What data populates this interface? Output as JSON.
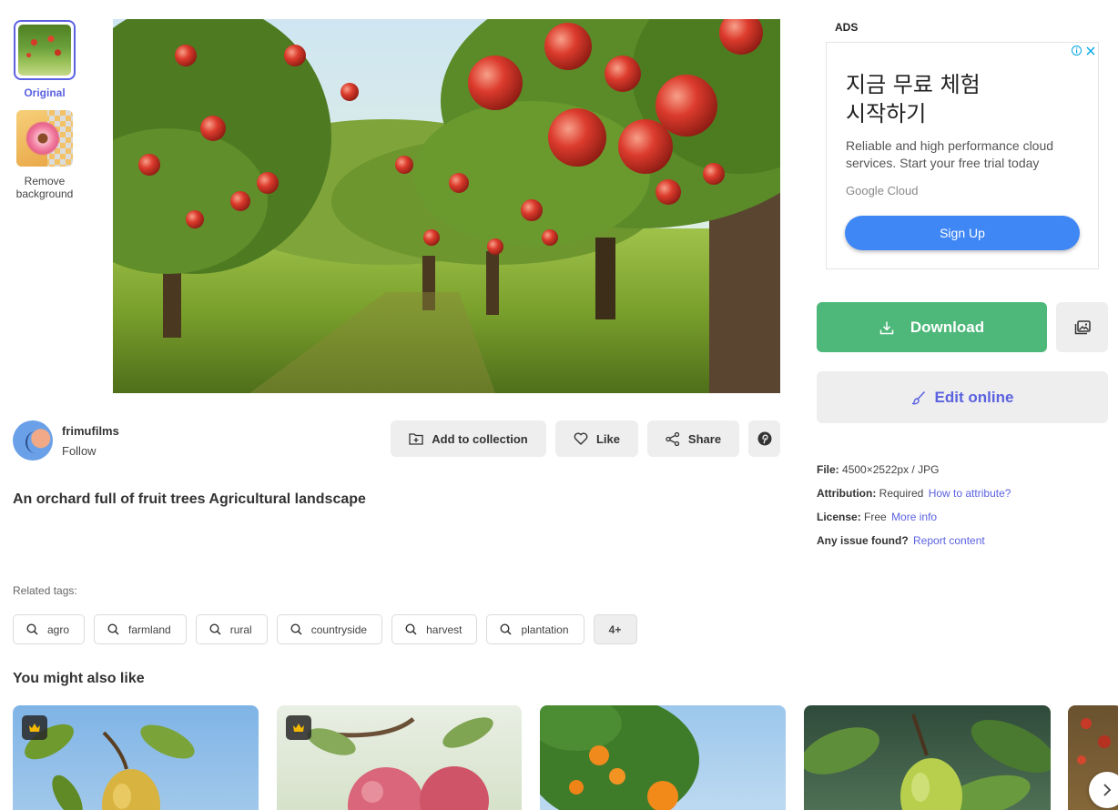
{
  "thumbnails": {
    "original_label": "Original",
    "remove_bg_label_line1": "Remove",
    "remove_bg_label_line2": "background"
  },
  "main_image": {
    "alt": "An orchard full of fruit trees Agricultural landscape"
  },
  "author": {
    "name": "frimufilms",
    "follow_label": "Follow"
  },
  "actions": {
    "add_to_collection": "Add to collection",
    "like": "Like",
    "share": "Share",
    "pinterest_icon": "pinterest-icon"
  },
  "title": "An orchard full of fruit trees Agricultural landscape",
  "related": {
    "label": "Related tags:",
    "tags": [
      "agro",
      "farmland",
      "rural",
      "countryside",
      "harvest",
      "plantation"
    ],
    "more": "4+"
  },
  "also_like": {
    "title": "You might also like",
    "cards": [
      {
        "name": "pear-on-branch",
        "premium": true
      },
      {
        "name": "pink-apples",
        "premium": true
      },
      {
        "name": "orange-tree",
        "premium": false
      },
      {
        "name": "green-pear-leaves",
        "premium": false
      },
      {
        "name": "orchard-partial",
        "premium": false
      }
    ]
  },
  "ads": {
    "label": "ADS",
    "headline_line1": "지금 무료 체험",
    "headline_line2": "시작하기",
    "body": "Reliable and high performance cloud services. Start your free trial today",
    "brand": "Google Cloud",
    "cta": "Sign Up"
  },
  "download": {
    "label": "Download",
    "edit_label": "Edit online"
  },
  "file_info": {
    "file_key": "File:",
    "file_value": "4500×2522px / JPG",
    "attribution_key": "Attribution:",
    "attribution_value": "Required",
    "attribution_link": "How to attribute?",
    "license_key": "License:",
    "license_value": "Free",
    "license_link": "More info",
    "issue_key": "Any issue found?",
    "issue_link": "Report content"
  },
  "colors": {
    "accent": "#5b62e0",
    "download_green": "#4db879",
    "ad_blue": "#3f87f5"
  }
}
